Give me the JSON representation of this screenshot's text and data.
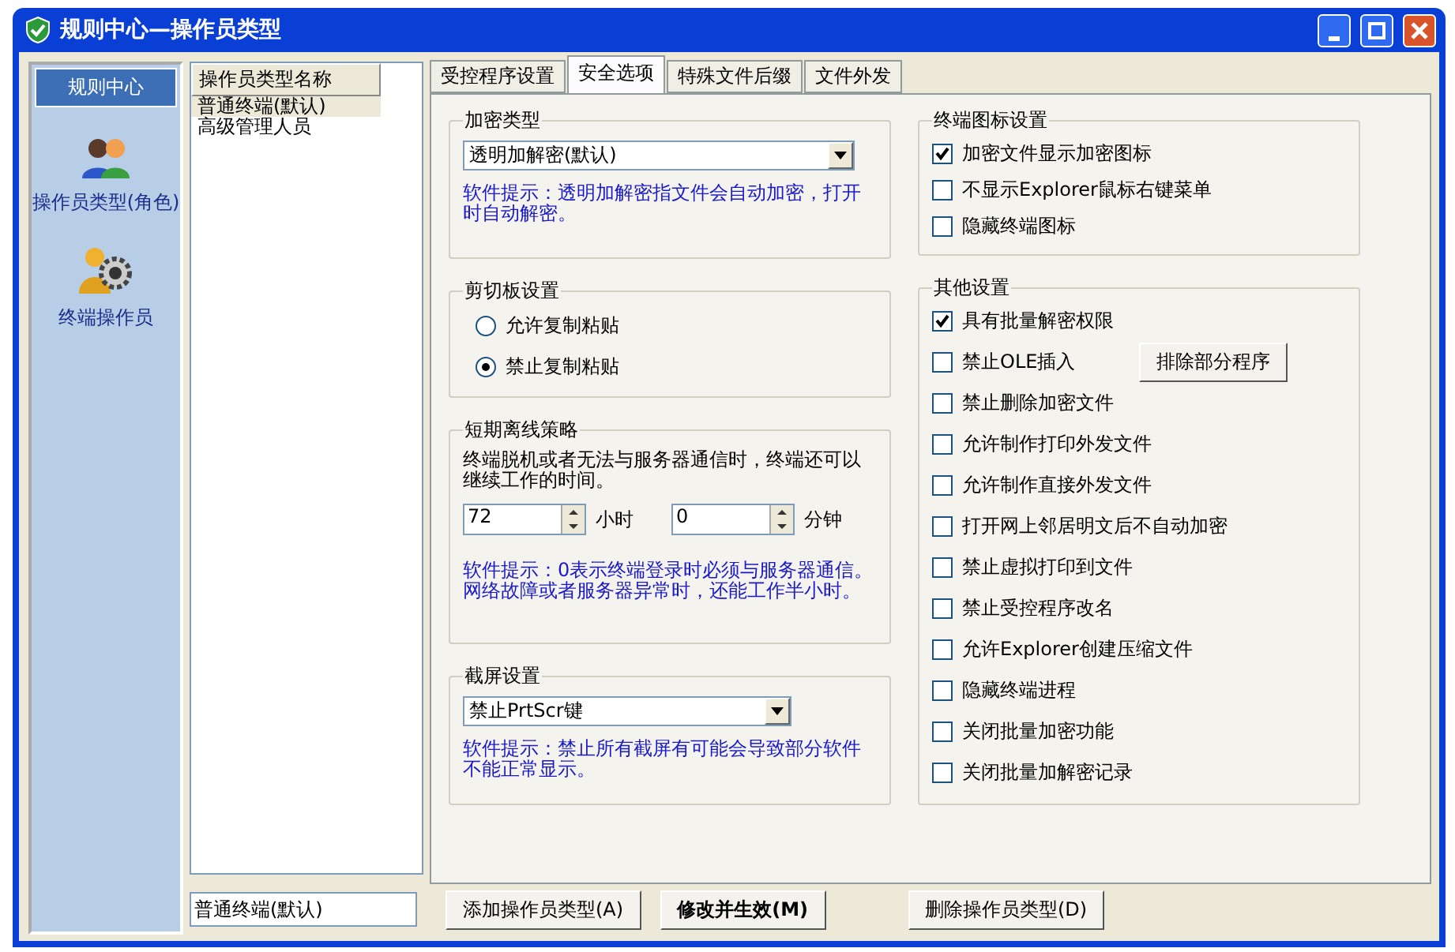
{
  "window": {
    "title": "规则中心—操作员类型"
  },
  "sidebar": {
    "header": "规则中心",
    "items": [
      {
        "label": "操作员类型(角色)",
        "kind": "roles"
      },
      {
        "label": "终端操作员",
        "kind": "operator"
      }
    ]
  },
  "type_list": {
    "column_header": "操作员类型名称",
    "rows": [
      {
        "label": "普通终端(默认)",
        "selected": true
      },
      {
        "label": "高级管理人员",
        "selected": false
      }
    ]
  },
  "tabs": [
    {
      "label": "受控程序设置",
      "selected": false
    },
    {
      "label": "安全选项",
      "selected": true
    },
    {
      "label": "特殊文件后缀",
      "selected": false
    },
    {
      "label": "文件外发",
      "selected": false
    }
  ],
  "encryption": {
    "title": "加密类型",
    "select_value": "透明加解密(默认)",
    "hint": "软件提示：透明加解密指文件会自动加密，打开时自动解密。"
  },
  "clipboard": {
    "title": "剪切板设置",
    "options": [
      {
        "label": "允许复制粘贴",
        "selected": false
      },
      {
        "label": "禁止复制粘贴",
        "selected": true
      }
    ]
  },
  "offline": {
    "title": "短期离线策略",
    "description": "终端脱机或者无法与服务器通信时，终端还可以继续工作的时间。",
    "hours": {
      "value": "72",
      "unit": "小时"
    },
    "minutes": {
      "value": "0",
      "unit": "分钟"
    },
    "hint": "软件提示：0表示终端登录时必须与服务器通信。网络故障或者服务器异常时，还能工作半小时。"
  },
  "screenshot": {
    "title": "截屏设置",
    "select_value": "禁止PrtScr键",
    "hint": "软件提示：禁止所有截屏有可能会导致部分软件不能正常显示。"
  },
  "terminal_icon": {
    "title": "终端图标设置",
    "options": [
      {
        "label": "加密文件显示加密图标",
        "checked": true
      },
      {
        "label": "不显示Explorer鼠标右键菜单",
        "checked": false
      },
      {
        "label": "隐藏终端图标",
        "checked": false
      }
    ]
  },
  "other": {
    "title": "其他设置",
    "options": [
      {
        "label": "具有批量解密权限",
        "checked": true
      },
      {
        "label": "禁止OLE插入",
        "checked": false,
        "button": "排除部分程序"
      },
      {
        "label": "禁止删除加密文件",
        "checked": false
      },
      {
        "label": "允许制作打印外发文件",
        "checked": false
      },
      {
        "label": "允许制作直接外发文件",
        "checked": false
      },
      {
        "label": "打开网上邻居明文后不自动加密",
        "checked": false
      },
      {
        "label": "禁止虚拟打印到文件",
        "checked": false
      },
      {
        "label": "禁止受控程序改名",
        "checked": false
      },
      {
        "label": "允许Explorer创建压缩文件",
        "checked": false
      },
      {
        "label": "隐藏终端进程",
        "checked": false
      },
      {
        "label": "关闭批量加密功能",
        "checked": false
      },
      {
        "label": "关闭批量加解密记录",
        "checked": false
      }
    ]
  },
  "name_field": {
    "value": "普通终端(默认)"
  },
  "buttons": [
    {
      "label": "添加操作员类型(A)",
      "kind": "normal"
    },
    {
      "label": "修改并生效(M)",
      "kind": "default"
    },
    {
      "label": "删除操作员类型(D)",
      "kind": "normal"
    }
  ]
}
